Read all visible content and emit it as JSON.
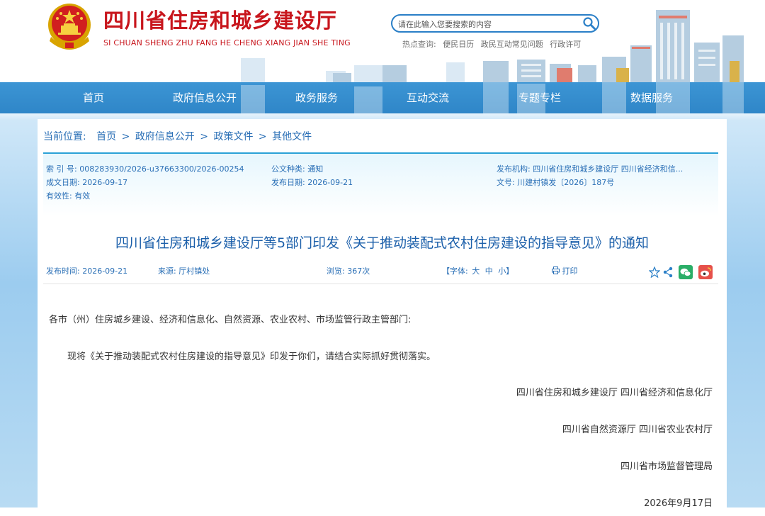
{
  "header": {
    "title": "四川省住房和城乡建设厅",
    "subtitle": "SI CHUAN SHENG ZHU FANG HE CHENG XIANG JIAN SHE TING",
    "search_placeholder": "请在此输入您要搜索的内容",
    "hot_label": "热点查询:",
    "hot_links": [
      "便民日历",
      "政民互动常见问题",
      "行政许可"
    ]
  },
  "nav": {
    "items": [
      "首页",
      "政府信息公开",
      "政务服务",
      "互动交流",
      "专题专栏",
      "数据服务"
    ]
  },
  "breadcrumb": {
    "label": "当前位置:",
    "items": [
      "首页",
      "政府信息公开",
      "政策文件",
      "其他文件"
    ],
    "separator": ">"
  },
  "meta": {
    "index_no": "索 引 号:  008283930/2026-u37663300/2026-00254",
    "doc_type": "公文种类:  通知",
    "publisher": "发布机构:  四川省住房和城乡建设厅   四川省经济和信...",
    "created_date": "成文日期:  2026-09-17",
    "publish_date": "发布日期:  2026-09-21",
    "doc_no": "文号:  川建村镇发〔2026〕187号",
    "validity": "有效性:  有效"
  },
  "article": {
    "title": "四川省住房和城乡建设厅等5部门印发《关于推动装配式农村住房建设的指导意见》的通知",
    "publish_time": "发布时间:  2026-09-21",
    "source": "来源:  厅村镇处",
    "views": "浏览:  367次",
    "font_label": "【字体:",
    "font_large": "大",
    "font_medium": "中",
    "font_small": "小】",
    "print_label": "打印",
    "salutation": "各市（州）住房城乡建设、经济和信息化、自然资源、农业农村、市场监管行政主管部门:",
    "body": "现将《关于推动装配式农村住房建设的指导意见》印发于你们，请结合实际抓好贯彻落实。",
    "signatures": [
      "四川省住房和城乡建设厅    四川省经济和信息化厅",
      "四川省自然资源厅    四川省农业农村厅",
      "四川省市场监督管理局"
    ],
    "sign_date": "2026年9月17日"
  },
  "colors": {
    "brand_red": "#c8161d",
    "nav_blue": "#2f86c8",
    "link_blue": "#2a6fb6",
    "title_blue": "#1b5faa",
    "wechat_green": "#2aae67",
    "weibo_red": "#e6504a"
  }
}
